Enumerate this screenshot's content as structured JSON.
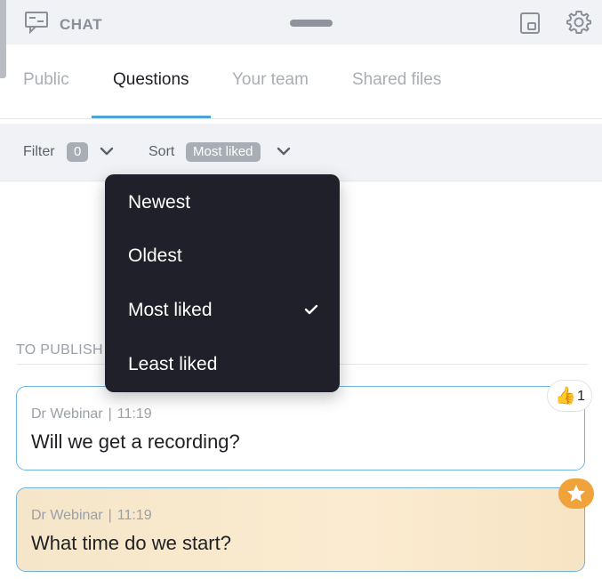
{
  "header": {
    "title": "CHAT",
    "icons": [
      "chat-icon",
      "popout-icon",
      "gear-icon"
    ]
  },
  "tabs": [
    {
      "label": "Public",
      "active": false
    },
    {
      "label": "Questions",
      "active": true
    },
    {
      "label": "Your team",
      "active": false
    },
    {
      "label": "Shared files",
      "active": false
    }
  ],
  "filterbar": {
    "filter_label": "Filter",
    "filter_count": "0",
    "sort_label": "Sort",
    "sort_value": "Most liked"
  },
  "sort_menu": {
    "items": [
      {
        "label": "Newest",
        "selected": false
      },
      {
        "label": "Oldest",
        "selected": false
      },
      {
        "label": "Most liked",
        "selected": true
      },
      {
        "label": "Least liked",
        "selected": false
      }
    ]
  },
  "section": {
    "label": "TO PUBLISH"
  },
  "questions": [
    {
      "author": "Dr Webinar",
      "separator": "|",
      "time": "11:19",
      "text": "Will we get a recording?",
      "likes": "1",
      "starred": false
    },
    {
      "author": "Dr Webinar",
      "separator": "|",
      "time": "11:19",
      "text": "What time do we start?",
      "starred": true
    }
  ],
  "colors": {
    "accent": "#4fa3d9",
    "menu_bg": "#1f2029",
    "star_badge": "#f0a23b",
    "highlight_card": "#fbebd0"
  }
}
